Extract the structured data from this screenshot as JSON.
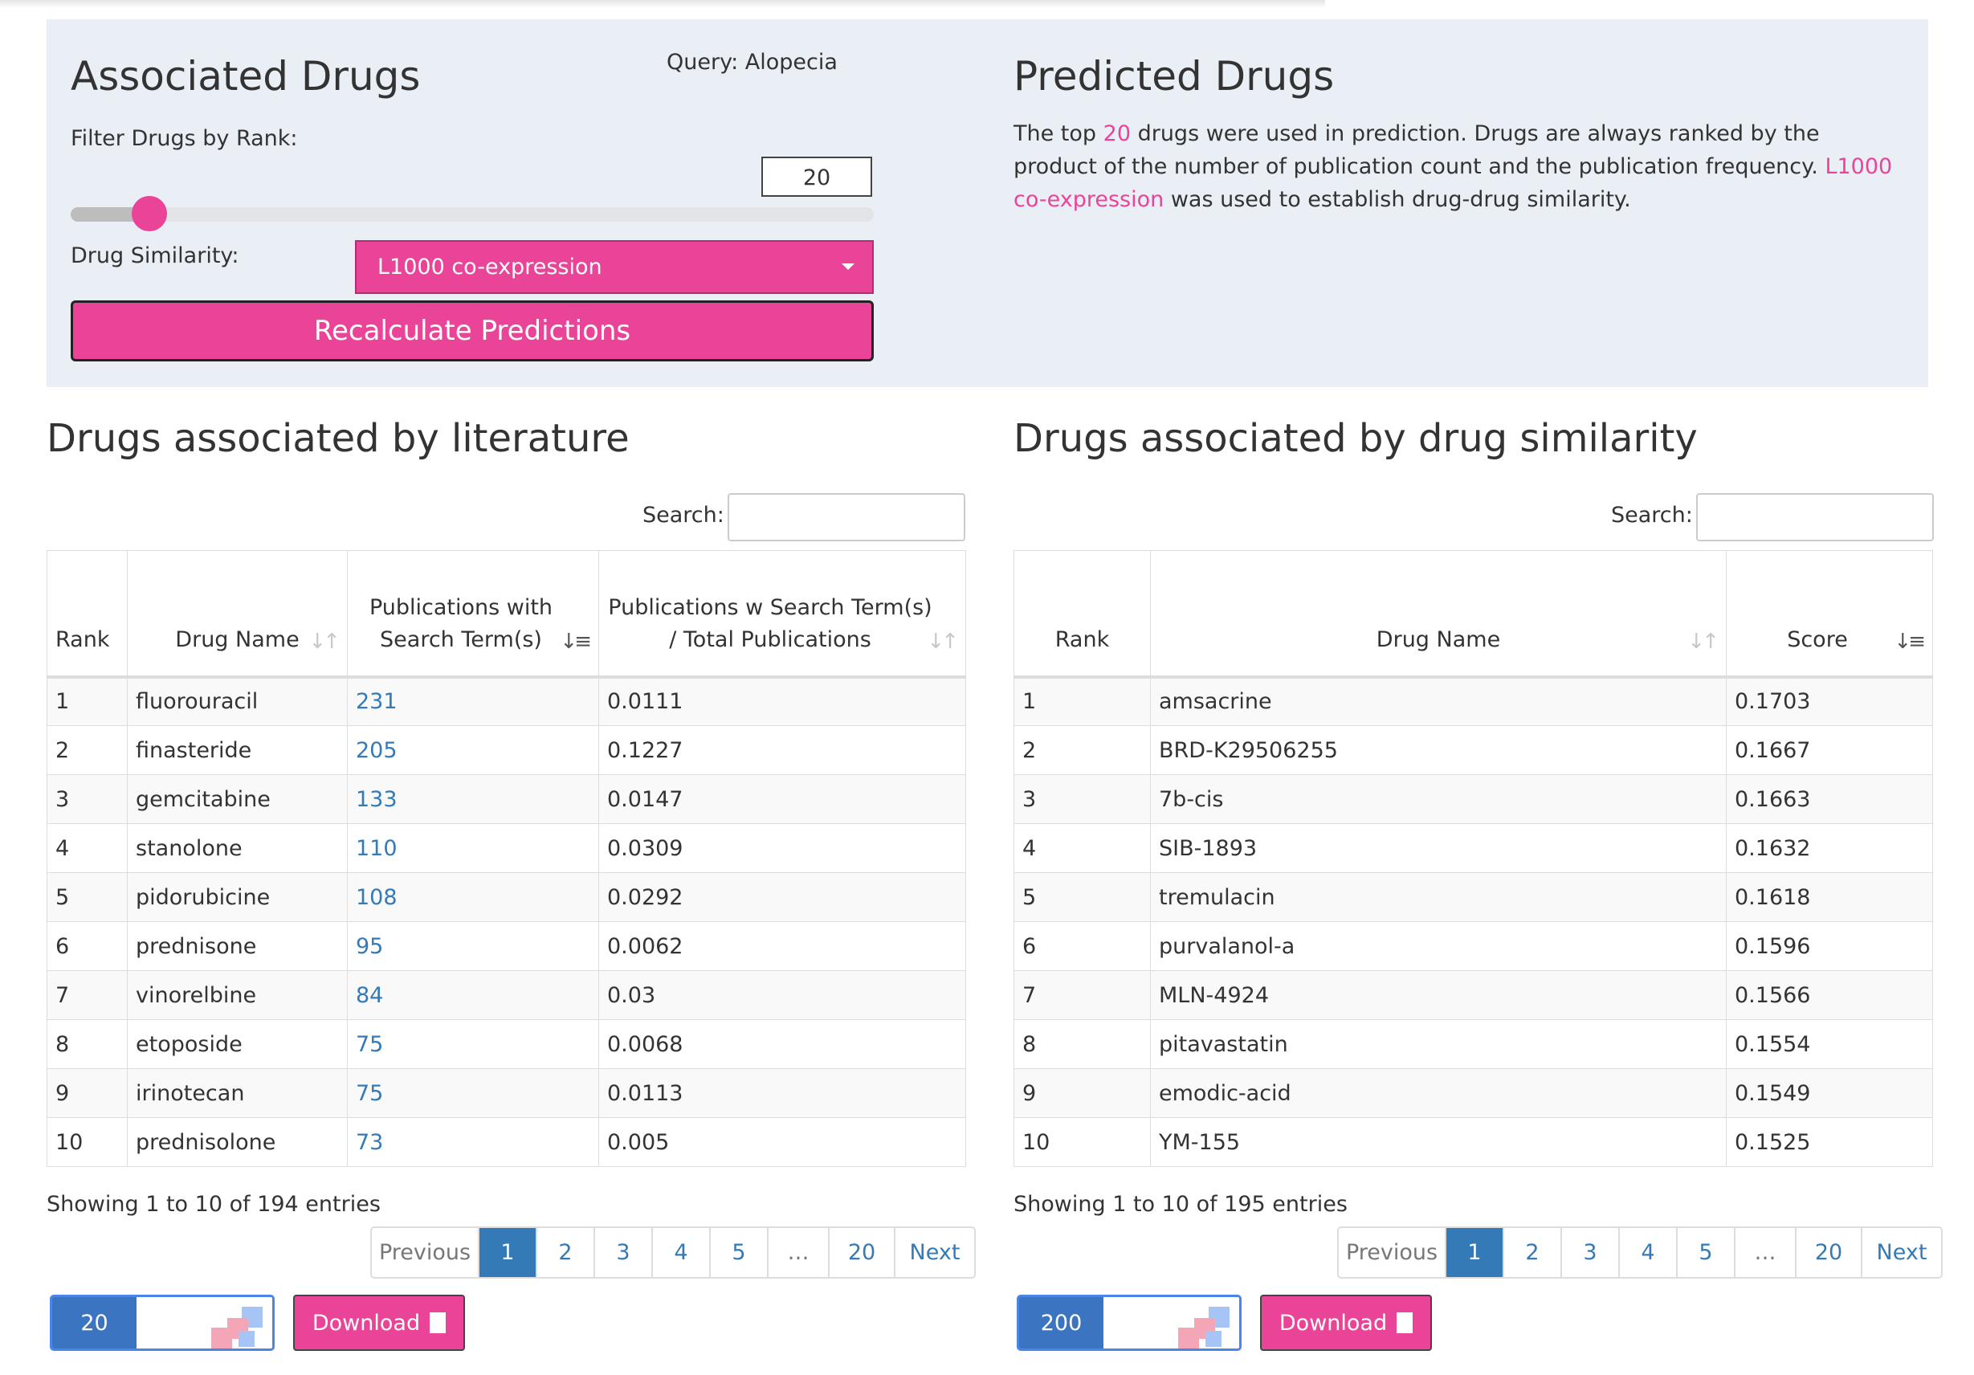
{
  "query_panel": {
    "associated_title": "Associated Drugs",
    "query_label": "Query: Alopecia",
    "filter_label": "Filter Drugs by Rank:",
    "rank_value": "20",
    "slider_level_fraction": 0.02,
    "similarity_label": "Drug Similarity:",
    "similarity_selected": "L1000 co-expression",
    "recalc_label": "Recalculate Predictions",
    "predicted_title": "Predicted Drugs",
    "desc_part1": "The top ",
    "desc_top_n": "20",
    "desc_part2": " drugs were used in prediction. Drugs are always ranked by the product of the number of publication count and the publication frequency. ",
    "desc_method": "L1000 co-expression",
    "desc_part3": " was used to establish drug-drug similarity."
  },
  "literature": {
    "title": "Drugs associated by literature",
    "search_label": "Search:",
    "headers": [
      "Rank",
      "Drug Name",
      "Publications with Search Term(s)",
      "Publications w Search Term(s) / Total Publications"
    ],
    "rows": [
      [
        "1",
        "fluorouracil",
        "231",
        "0.0111"
      ],
      [
        "2",
        "finasteride",
        "205",
        "0.1227"
      ],
      [
        "3",
        "gemcitabine",
        "133",
        "0.0147"
      ],
      [
        "4",
        "stanolone",
        "110",
        "0.0309"
      ],
      [
        "5",
        "pidorubicine",
        "108",
        "0.0292"
      ],
      [
        "6",
        "prednisone",
        "95",
        "0.0062"
      ],
      [
        "7",
        "vinorelbine",
        "84",
        "0.03"
      ],
      [
        "8",
        "etoposide",
        "75",
        "0.0068"
      ],
      [
        "9",
        "irinotecan",
        "75",
        "0.0113"
      ],
      [
        "10",
        "prednisolone",
        "73",
        "0.005"
      ]
    ],
    "showing": "Showing 1 to 10 of 194 entries",
    "pager": [
      "Previous",
      "1",
      "2",
      "3",
      "4",
      "5",
      "…",
      "20",
      "Next"
    ],
    "mini_count": "20",
    "download_label": "Download"
  },
  "similarity": {
    "title": "Drugs associated by drug similarity",
    "search_label": "Search:",
    "headers": [
      "Rank",
      "Drug Name",
      "Score"
    ],
    "rows": [
      [
        "1",
        "amsacrine",
        "0.1703"
      ],
      [
        "2",
        "BRD-K29506255",
        "0.1667"
      ],
      [
        "3",
        "7b-cis",
        "0.1663"
      ],
      [
        "4",
        "SIB-1893",
        "0.1632"
      ],
      [
        "5",
        "tremulacin",
        "0.1618"
      ],
      [
        "6",
        "purvalanol-a",
        "0.1596"
      ],
      [
        "7",
        "MLN-4924",
        "0.1566"
      ],
      [
        "8",
        "pitavastatin",
        "0.1554"
      ],
      [
        "9",
        "emodic-acid",
        "0.1549"
      ],
      [
        "10",
        "YM-155",
        "0.1525"
      ]
    ],
    "showing": "Showing 1 to 10 of 195 entries",
    "pager": [
      "Previous",
      "1",
      "2",
      "3",
      "4",
      "5",
      "…",
      "20",
      "Next"
    ],
    "mini_count": "200",
    "download_label": "Download"
  },
  "colors": {
    "accent": "#ea4499",
    "link": "#337ab7",
    "panel_bg": "#eaeff6"
  }
}
